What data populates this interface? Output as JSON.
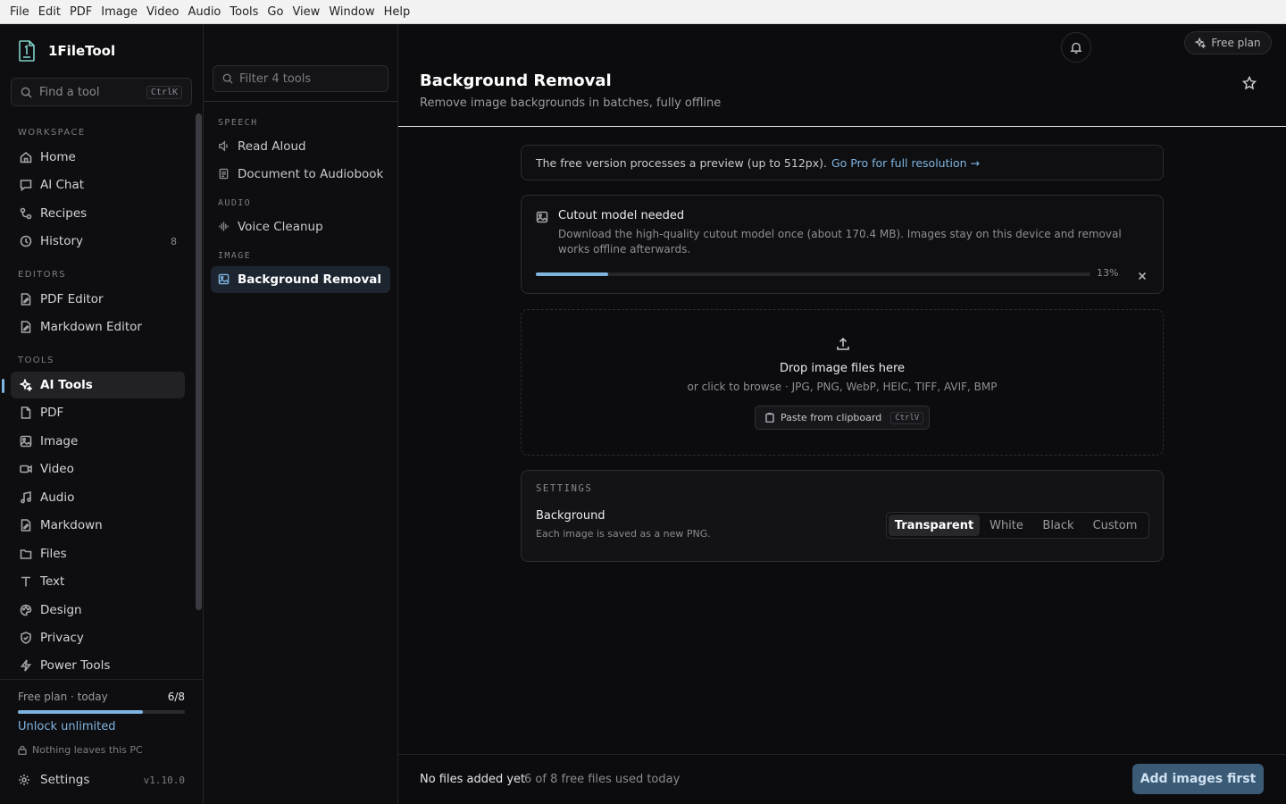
{
  "menubar": [
    "File",
    "Edit",
    "PDF",
    "Image",
    "Video",
    "Audio",
    "Tools",
    "Go",
    "View",
    "Window",
    "Help"
  ],
  "app": {
    "name": "1FileTool",
    "version": "v1.10.0"
  },
  "search": {
    "placeholder": "Find a tool",
    "shortcut": "CtrlK"
  },
  "sidebar": {
    "sections": {
      "workspace": "WORKSPACE",
      "editors": "EDITORS",
      "tools": "TOOLS"
    },
    "workspace_items": [
      {
        "label": "Home",
        "icon": "home-icon"
      },
      {
        "label": "AI Chat",
        "icon": "chat-icon"
      },
      {
        "label": "Recipes",
        "icon": "recipes-icon"
      },
      {
        "label": "History",
        "icon": "history-icon",
        "count": "8"
      }
    ],
    "editor_items": [
      {
        "label": "PDF Editor",
        "icon": "pdf-editor-icon"
      },
      {
        "label": "Markdown Editor",
        "icon": "markdown-editor-icon"
      }
    ],
    "tool_items": [
      {
        "label": "AI Tools",
        "icon": "sparkles-icon",
        "active": true
      },
      {
        "label": "PDF",
        "icon": "file-icon"
      },
      {
        "label": "Image",
        "icon": "image-icon"
      },
      {
        "label": "Video",
        "icon": "video-icon"
      },
      {
        "label": "Audio",
        "icon": "music-icon"
      },
      {
        "label": "Markdown",
        "icon": "markdown-icon"
      },
      {
        "label": "Files",
        "icon": "folder-icon"
      },
      {
        "label": "Text",
        "icon": "text-icon"
      },
      {
        "label": "Design",
        "icon": "palette-icon"
      },
      {
        "label": "Privacy",
        "icon": "shield-icon"
      },
      {
        "label": "Power Tools",
        "icon": "bolt-icon"
      }
    ],
    "footer": {
      "plan_label": "Free plan · today",
      "plan_usage": "6/8",
      "plan_progress": 0.75,
      "unlock": "Unlock unlimited",
      "privacy_note": "Nothing leaves this PC",
      "settings": "Settings"
    }
  },
  "tools_panel": {
    "filter_placeholder": "Filter 4 tools",
    "sections": [
      {
        "label": "SPEECH",
        "items": [
          {
            "label": "Read Aloud",
            "icon": "speaker-icon"
          },
          {
            "label": "Document to Audiobook",
            "icon": "document-icon"
          }
        ]
      },
      {
        "label": "AUDIO",
        "items": [
          {
            "label": "Voice Cleanup",
            "icon": "waveform-icon"
          }
        ]
      },
      {
        "label": "IMAGE",
        "items": [
          {
            "label": "Background Removal",
            "icon": "image-cutout-icon",
            "active": true
          }
        ]
      }
    ]
  },
  "header": {
    "free_plan": "Free plan",
    "title": "Background Removal",
    "subtitle": "Remove image backgrounds in batches, fully offline"
  },
  "notice": {
    "text": "The free version processes a preview (up to 512px).",
    "link": "Go Pro for full resolution →"
  },
  "model": {
    "title": "Cutout model needed",
    "description": "Download the high-quality cutout model once (about 170.4 MB). Images stay on this device and removal works offline afterwards.",
    "progress": 0.13,
    "percent_label": "13%"
  },
  "dropzone": {
    "title": "Drop image files here",
    "subtitle": "or click to browse · JPG, PNG, WebP, HEIC, TIFF, AVIF, BMP",
    "paste_label": "Paste from clipboard",
    "paste_shortcut": "CtrlV"
  },
  "settings_card": {
    "label": "SETTINGS",
    "background_label": "Background",
    "background_desc": "Each image is saved as a new PNG.",
    "options": [
      "Transparent",
      "White",
      "Black",
      "Custom"
    ],
    "selected": "Transparent"
  },
  "footer": {
    "status": "No files added yet",
    "usage": "6 of 8 free files used today",
    "action": "Add images first"
  },
  "colors": {
    "accent": "#7fb4e0",
    "background": "#0c0c0e",
    "button": "#3b5a75"
  }
}
